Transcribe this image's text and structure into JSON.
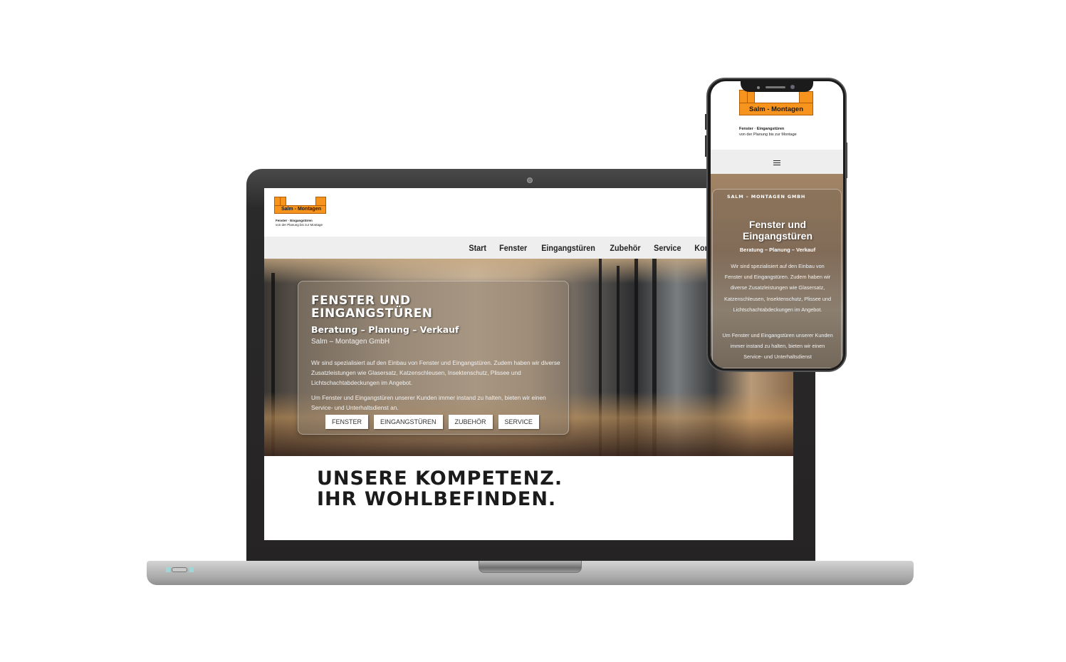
{
  "desktop": {
    "logo": {
      "brand": "Salm - Montagen",
      "tagline_1": "Fenster · Eingangstüren",
      "tagline_2": "von der Planung bis zur Montage"
    },
    "nav": [
      {
        "label": "Start"
      },
      {
        "label": "Fenster"
      },
      {
        "label": "Eingangstüren"
      },
      {
        "label": "Zubehör"
      },
      {
        "label": "Service"
      },
      {
        "label": "Kontakt"
      }
    ],
    "hero": {
      "title_line1": "FENSTER UND",
      "title_line2": "EINGANGSTÜREN",
      "subtitle": "Beratung – Planung – Verkauf",
      "company": "Salm – Montagen GmbH",
      "paragraph_1": "Wir sind spezialisiert auf den Einbau von Fenster und Eingangstüren. Zudem haben wir diverse Zusatzleistungen wie Glasersatz, Katzenschleusen, Insektenschutz, Plissee und Lichtschachtabdeckungen im Angebot.",
      "paragraph_2": "Um Fenster und Eingangstüren unserer Kunden immer instand zu halten, bieten wir einen Service- und Unterhaltsdienst an.",
      "buttons": [
        {
          "label": "FENSTER"
        },
        {
          "label": "EINGANGSTÜREN"
        },
        {
          "label": "ZUBEHÖR"
        },
        {
          "label": "SERVICE"
        }
      ]
    },
    "claim_line1": "UNSERE KOMPETENZ.",
    "claim_line2": "IHR WOHLBEFINDEN."
  },
  "mobile": {
    "logo": {
      "brand": "Salm - Montagen",
      "tagline_1": "Fenster · Eingangstüren",
      "tagline_2": "von der Planung bis zur Montage"
    },
    "menu_icon": "hamburger-icon",
    "hero": {
      "company": "SALM – MONTAGEN GMBH",
      "title_line1": "Fenster und",
      "title_line2": "Eingangstüren",
      "subtitle": "Beratung – Planung – Verkauf",
      "paragraph_1": "Wir sind spezialisiert auf den Einbau von Fenster und Eingangstüren. Zudem haben wir diverse Zusatzleistungen wie Glasersatz, Katzenschleusen, Insektenschutz, Plissee und Lichtschachtabdeckungen im Angebot.",
      "paragraph_2": "Um Fenster und Eingangstüren unserer Kunden immer instand zu halten, bieten wir einen Service- und Unterhaltsdienst"
    }
  },
  "colors": {
    "brand_orange": "#f7941d",
    "nav_bg": "#eeeeee",
    "text_dark": "#1b1b1b"
  }
}
